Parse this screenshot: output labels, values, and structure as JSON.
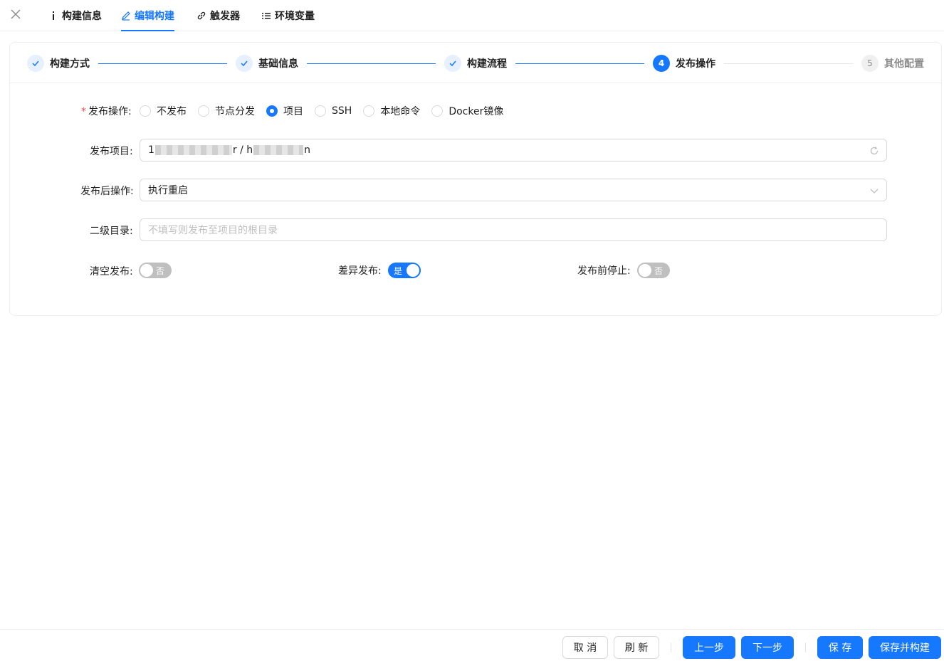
{
  "tabs": [
    {
      "label": "构建信息",
      "icon": "info-icon"
    },
    {
      "label": "编辑构建",
      "icon": "edit-icon"
    },
    {
      "label": "触发器",
      "icon": "link-icon"
    },
    {
      "label": "环境变量",
      "icon": "list-icon"
    }
  ],
  "active_tab": "编辑构建",
  "steps": [
    {
      "label": "构建方式",
      "status": "done"
    },
    {
      "label": "基础信息",
      "status": "done"
    },
    {
      "label": "构建流程",
      "status": "done"
    },
    {
      "label": "发布操作",
      "status": "active",
      "number": "4"
    },
    {
      "label": "其他配置",
      "status": "wait",
      "number": "5"
    }
  ],
  "form": {
    "release_label": "发布操作:",
    "release_options": [
      "不发布",
      "节点分发",
      "项目",
      "SSH",
      "本地命令",
      "Docker镜像"
    ],
    "release_selected": "项目",
    "project_label": "发布项目:",
    "project_value_start": "1",
    "project_value_mid": "r / h",
    "project_value_end": "n",
    "after_label": "发布后操作:",
    "after_value": "执行重启",
    "subdir_label": "二级目录:",
    "subdir_placeholder": "不填写则发布至项目的根目录",
    "clean_label": "清空发布:",
    "clean_state": "否",
    "diff_label": "差异发布:",
    "diff_state": "是",
    "stop_label": "发布前停止:",
    "stop_state": "否"
  },
  "footer": {
    "cancel": "取 消",
    "refresh": "刷 新",
    "prev": "上一步",
    "next": "下一步",
    "save": "保 存",
    "save_build": "保存并构建"
  },
  "colors": {
    "primary": "#1677ff",
    "required": "#ff4d4f",
    "border": "#d9d9d9"
  }
}
